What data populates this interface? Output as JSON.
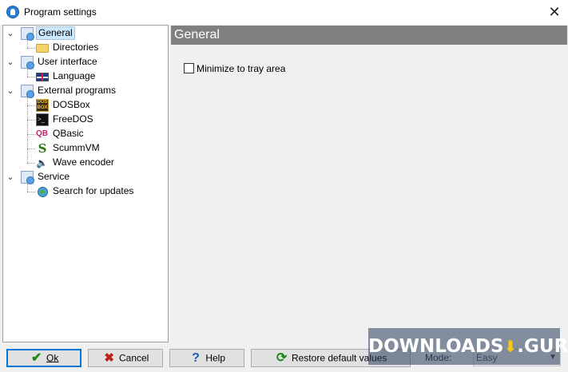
{
  "window": {
    "title": "Program settings",
    "icon": "app-icon"
  },
  "tree": {
    "items": [
      {
        "label": "General",
        "icon": "settings-icon",
        "level": 0,
        "expanded": true,
        "selected": true
      },
      {
        "label": "Directories",
        "icon": "folder-icon",
        "level": 1
      },
      {
        "label": "User interface",
        "icon": "settings-icon",
        "level": 0,
        "expanded": true
      },
      {
        "label": "Language",
        "icon": "uk-flag-icon",
        "level": 1
      },
      {
        "label": "External programs",
        "icon": "settings-icon",
        "level": 0,
        "expanded": true
      },
      {
        "label": "DOSBox",
        "icon": "dosbox-icon",
        "level": 1
      },
      {
        "label": "FreeDOS",
        "icon": "terminal-icon",
        "level": 1
      },
      {
        "label": "QBasic",
        "icon": "qbasic-icon",
        "level": 1
      },
      {
        "label": "ScummVM",
        "icon": "scummvm-icon",
        "level": 1
      },
      {
        "label": "Wave encoder",
        "icon": "speaker-icon",
        "level": 1
      },
      {
        "label": "Service",
        "icon": "settings-icon",
        "level": 0,
        "expanded": true
      },
      {
        "label": "Search for updates",
        "icon": "globe-icon",
        "level": 1
      }
    ]
  },
  "panel": {
    "title": "General",
    "minimize_checkbox": {
      "label": "Minimize to tray area",
      "checked": false
    }
  },
  "buttons": {
    "ok": "Ok",
    "cancel": "Cancel",
    "help": "Help",
    "restore": "Restore default values"
  },
  "mode": {
    "label": "Mode:",
    "value": "Easy"
  },
  "watermark": {
    "text_left": "DOWNLOADS",
    "text_right": "GURU"
  },
  "colors": {
    "panel_header": "#808080",
    "selection": "#cce8ff",
    "default_button_border": "#0078d7"
  }
}
